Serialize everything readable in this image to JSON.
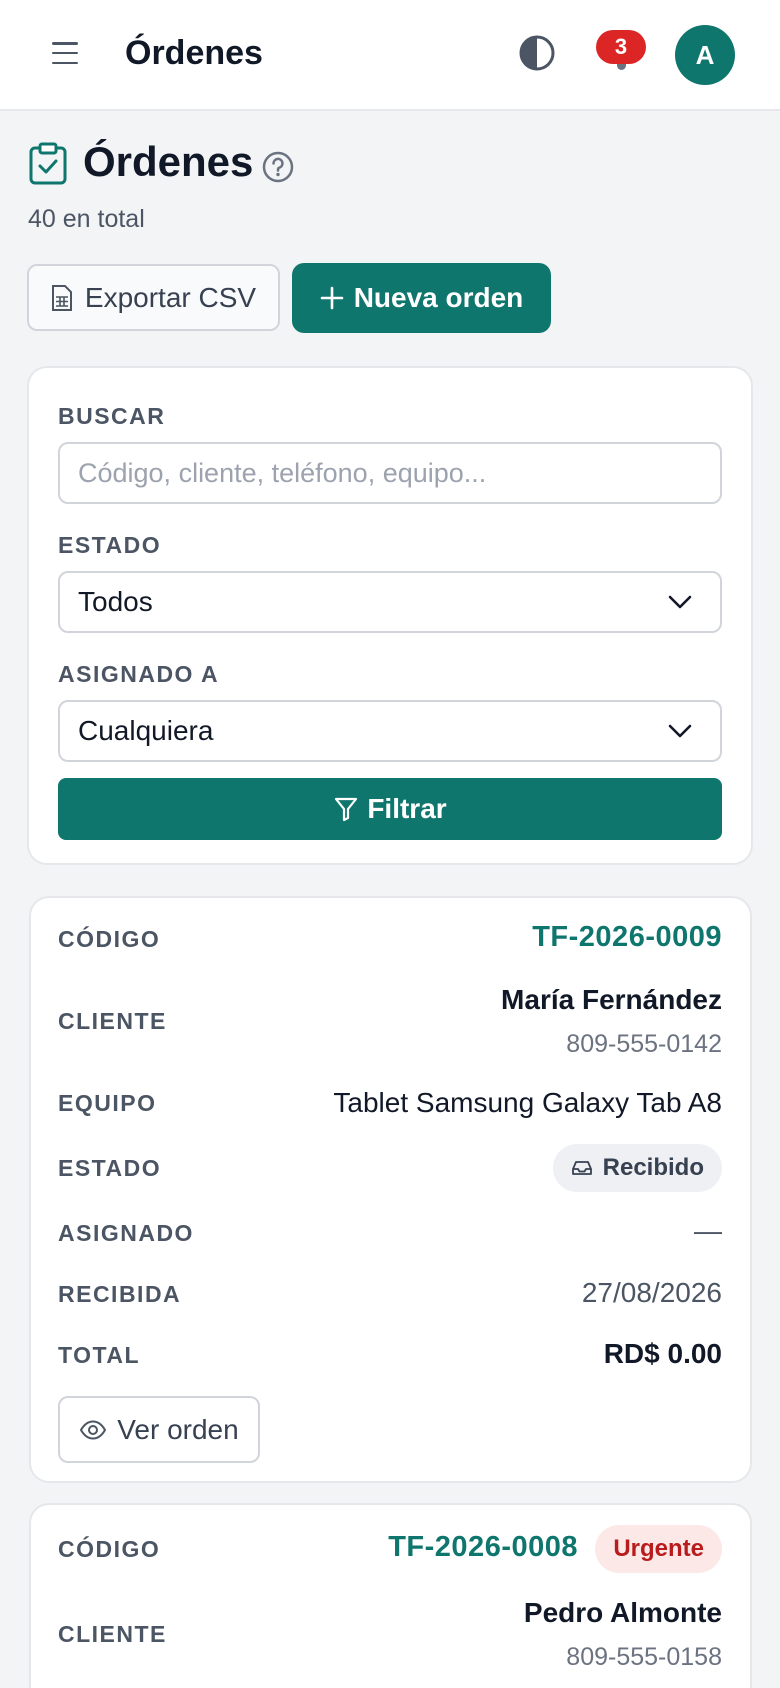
{
  "topbar": {
    "title": "Órdenes",
    "notifications_count": "3",
    "avatar_initial": "A"
  },
  "header": {
    "title": "Órdenes",
    "subtitle": "40 en total",
    "export_label": "Exportar CSV",
    "new_label": "Nueva orden"
  },
  "filters": {
    "search_label": "BUSCAR",
    "search_placeholder": "Código, cliente, teléfono, equipo...",
    "search_value": "",
    "status_label": "ESTADO",
    "status_value": "Todos",
    "assigned_label": "ASIGNADO A",
    "assigned_value": "Cualquiera",
    "filter_button": "Filtrar"
  },
  "labels": {
    "code": "CÓDIGO",
    "client": "CLIENTE",
    "device": "EQUIPO",
    "status": "ESTADO",
    "assigned": "ASIGNADO",
    "received": "RECIBIDA",
    "total": "TOTAL",
    "view_button": "Ver orden"
  },
  "orders": [
    {
      "code": "TF-2026-0009",
      "client": "María Fernández",
      "phone": "809-555-0142",
      "device": "Tablet Samsung Galaxy Tab A8",
      "status": "Recibido",
      "assigned": "—",
      "received": "27/08/2026",
      "total": "RD$ 0.00"
    },
    {
      "code": "TF-2026-0008",
      "priority": "Urgente",
      "client": "Pedro Almonte",
      "phone": "809-555-0158"
    }
  ],
  "colors": {
    "accent": "#0f766e",
    "badge": "#dc2626",
    "urgent_bg": "#fde8e8",
    "urgent_text": "#b91c1c"
  }
}
